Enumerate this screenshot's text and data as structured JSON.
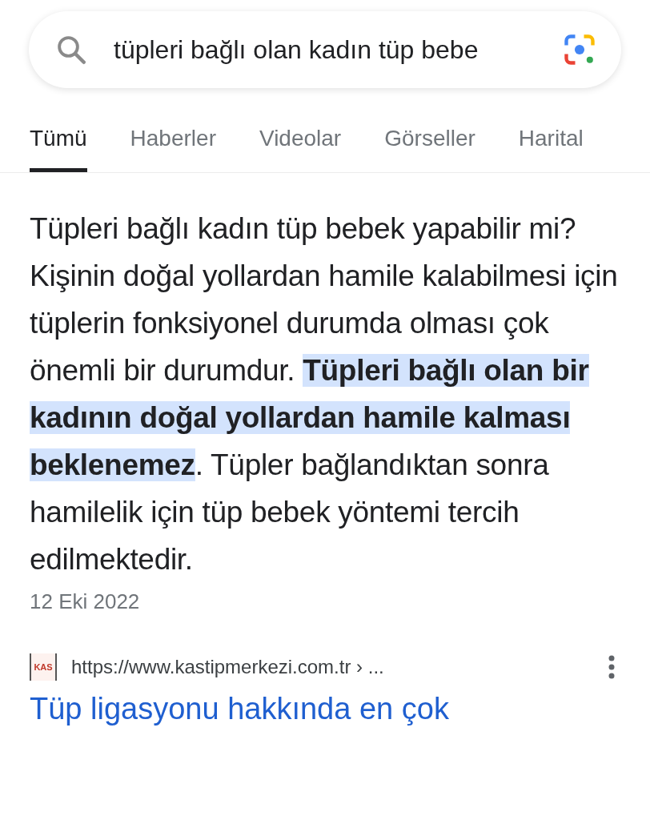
{
  "search": {
    "value": "tüpleri bağlı olan kadın tüp bebe"
  },
  "tabs": [
    {
      "label": "Tümü",
      "selected": true
    },
    {
      "label": "Haberler",
      "selected": false
    },
    {
      "label": "Videolar",
      "selected": false
    },
    {
      "label": "Görseller",
      "selected": false
    },
    {
      "label": "Harital",
      "selected": false
    }
  ],
  "snippet": {
    "before": "Tüpleri bağlı kadın tüp bebek yapabilir mi? Kişinin doğal yollardan hamile kalabilmesi için tüplerin fonksiyonel durumda olması çok önemli bir durumdur. ",
    "highlight": "Tüpleri bağlı olan bir kadının doğal yollardan hamile kalması beklenemez",
    "after": ". Tüpler bağlandıktan sonra hamilelik için tüp bebek yöntemi tercih edilmektedir.",
    "date": "12 Eki 2022"
  },
  "result": {
    "favicon": "KAS",
    "url": "https://www.kastipmerkezi.com.tr › ...",
    "title": "Tüp ligasyonu hakkında en çok"
  }
}
